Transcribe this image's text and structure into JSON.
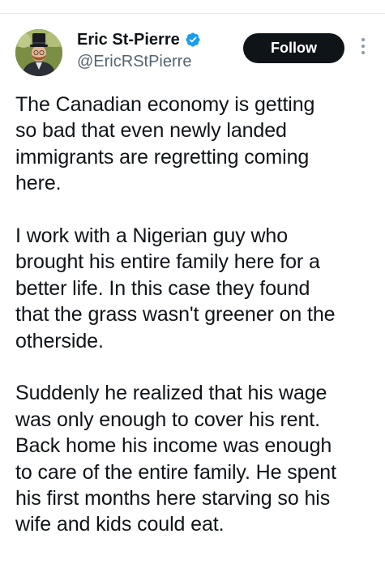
{
  "author": {
    "display_name": "Eric St-Pierre",
    "handle": "@EricRStPierre",
    "verified": true,
    "verified_icon": "verified-badge-icon",
    "avatar": "avatar-photo"
  },
  "actions": {
    "follow_label": "Follow",
    "more_icon": "more-options-icon"
  },
  "tweet": {
    "paragraphs": [
      {
        "lines": [
          "The Canadian economy is getting",
          "so bad that even newly landed",
          "immigrants are regretting coming",
          "here."
        ]
      },
      {
        "lines": [
          "I work with a Nigerian guy who",
          "brought his entire family here for a",
          "better life. In this case they found",
          "that the grass wasn't greener on the",
          "otherside."
        ]
      },
      {
        "lines": [
          "Suddenly he realized that his wage",
          "was only enough to cover his rent.",
          "Back home his income was enough",
          "to care of the entire family. He spent",
          "his first months here starving so his",
          "wife and kids could eat."
        ]
      }
    ]
  },
  "colors": {
    "text": "#0f1419",
    "secondary_text": "#536471",
    "verified_blue": "#1d9bf0",
    "follow_bg": "#0f1419",
    "follow_text": "#ffffff"
  }
}
